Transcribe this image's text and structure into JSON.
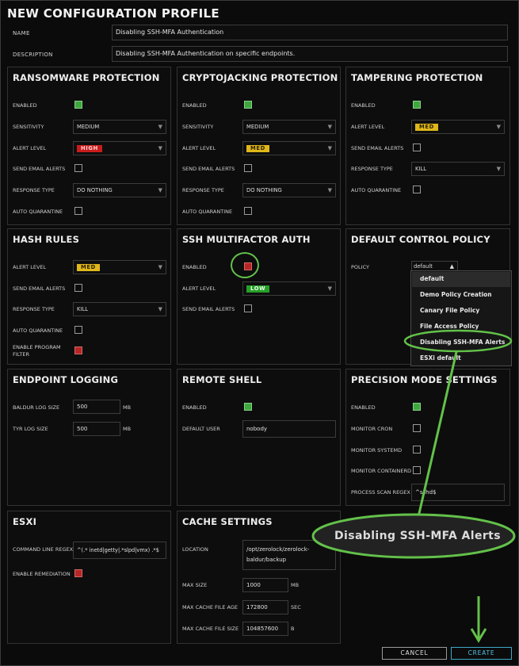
{
  "header": {
    "title": "NEW CONFIGURATION PROFILE",
    "name_label": "NAME",
    "name_value": "Disabling SSH-MFA Authentication",
    "description_label": "DESCRIPTION",
    "description_value": "Disabling SSH-MFA Authentication on specific endpoints."
  },
  "ransomware": {
    "title": "RANSOMWARE PROTECTION",
    "enabled_label": "ENABLED",
    "sensitivity_label": "SENSITIVITY",
    "sensitivity_value": "MEDIUM",
    "alert_label": "ALERT LEVEL",
    "alert_value": "HIGH",
    "email_label": "SEND EMAIL ALERTS",
    "response_label": "RESPONSE TYPE",
    "response_value": "DO NOTHING",
    "quarantine_label": "AUTO QUARANTINE"
  },
  "crypto": {
    "title": "CRYPTOJACKING PROTECTION",
    "enabled_label": "ENABLED",
    "sensitivity_label": "SENSITIVITY",
    "sensitivity_value": "MEDIUM",
    "alert_label": "ALERT LEVEL",
    "alert_value": "MED",
    "email_label": "SEND EMAIL ALERTS",
    "response_label": "RESPONSE TYPE",
    "response_value": "DO NOTHING",
    "quarantine_label": "AUTO QUARANTINE"
  },
  "tamper": {
    "title": "TAMPERING PROTECTION",
    "enabled_label": "ENABLED",
    "alert_label": "ALERT LEVEL",
    "alert_value": "MED",
    "email_label": "SEND EMAIL ALERTS",
    "response_label": "RESPONSE TYPE",
    "response_value": "KILL",
    "quarantine_label": "AUTO QUARANTINE"
  },
  "hash": {
    "title": "HASH RULES",
    "alert_label": "ALERT LEVEL",
    "alert_value": "MED",
    "email_label": "SEND EMAIL ALERTS",
    "response_label": "RESPONSE TYPE",
    "response_value": "KILL",
    "quarantine_label": "AUTO QUARANTINE",
    "program_filter_label_1": "ENABLE PROGRAM",
    "program_filter_label_2": "FILTER"
  },
  "ssh": {
    "title": "SSH MULTIFACTOR AUTH",
    "enabled_label": "ENABLED",
    "alert_label": "ALERT LEVEL",
    "alert_value": "LOW",
    "email_label": "SEND EMAIL ALERTS"
  },
  "policy": {
    "title": "DEFAULT CONTROL POLICY",
    "policy_label": "POLICY",
    "policy_value": "default",
    "options": [
      "default",
      "Demo Policy Creation",
      "Canary File Policy",
      "File Access Policy",
      "Disabling SSH-MFA Alerts",
      "ESXi default"
    ]
  },
  "logging": {
    "title": "ENDPOINT LOGGING",
    "baldur_label": "BALDUR LOG SIZE",
    "baldur_value": "500",
    "baldur_unit": "MB",
    "tyr_label": "TYR LOG SIZE",
    "tyr_value": "500",
    "tyr_unit": "MB"
  },
  "shell": {
    "title": "REMOTE SHELL",
    "enabled_label": "ENABLED",
    "user_label": "DEFAULT USER",
    "user_value": "nobody"
  },
  "precision": {
    "title": "PRECISION MODE SETTINGS",
    "enabled_label": "ENABLED",
    "cron_label": "MONITOR CRON",
    "systemd_label": "MONITOR SYSTEMD",
    "containerd_label": "MONITOR CONTAINERD",
    "regex_label": "PROCESS SCAN REGEX",
    "regex_value": "^sshd$"
  },
  "esxi": {
    "title": "ESXI",
    "cmd_label": "COMMAND LINE REGEX",
    "cmd_value": "^(.* inetd|getty|.*slpd|vmx) .*$",
    "remediation_label": "ENABLE REMEDIATION"
  },
  "cache": {
    "title": "CACHE SETTINGS",
    "location_label": "LOCATION",
    "location_line1": "/opt/zerolock/zerolock-",
    "location_line2": "baldur/backup",
    "maxsize_label": "MAX SIZE",
    "maxsize_value": "1000",
    "maxsize_unit": "MB",
    "age_label": "MAX CACHE FILE AGE",
    "age_value": "172800",
    "age_unit": "SEC",
    "filesize_label": "MAX CACHE FILE SIZE",
    "filesize_value": "104857600",
    "filesize_unit": "B"
  },
  "footer": {
    "cancel_label": "CANCEL",
    "create_label": "CREATE"
  },
  "annotation": {
    "zoom_text": "Disabling SSH-MFA Alerts",
    "accent": "#63c14a"
  },
  "colors": {
    "enabled_green": "#3ea83e",
    "disabled_red": "#b82525",
    "high": "#c81c1c",
    "med": "#e0b71a",
    "low": "#27a02a",
    "create": "#57c3e2"
  }
}
